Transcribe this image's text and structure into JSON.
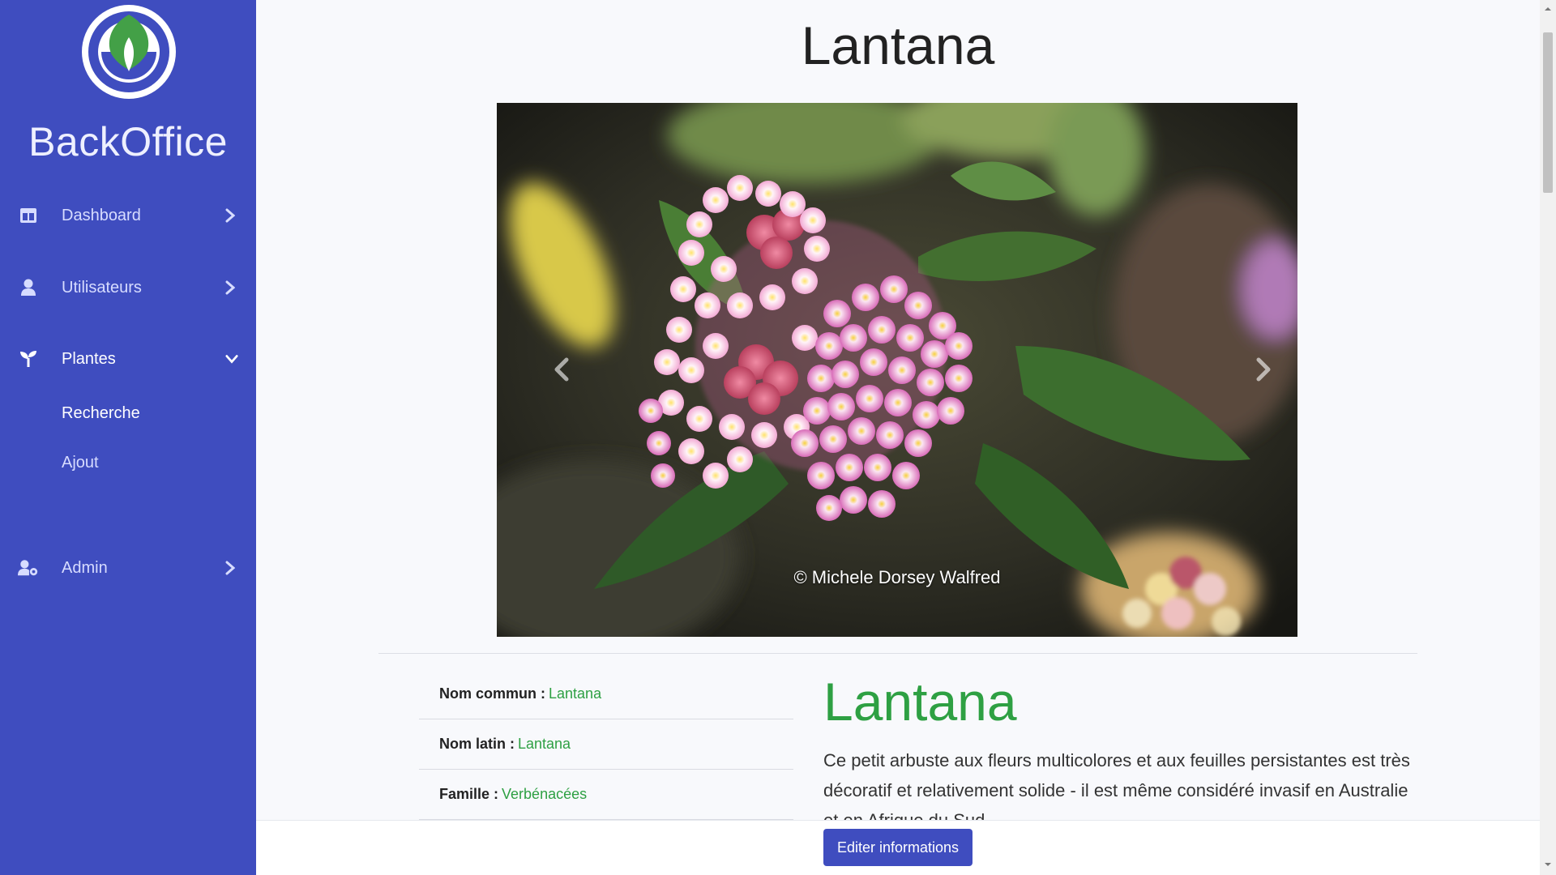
{
  "sidebar": {
    "brand": "BackOffice",
    "items": [
      {
        "label": "Dashboard",
        "icon": "dashboard-icon"
      },
      {
        "label": "Utilisateurs",
        "icon": "user-icon"
      },
      {
        "label": "Plantes",
        "icon": "sprout-icon",
        "expanded": true
      },
      {
        "label": "Admin",
        "icon": "user-cog-icon"
      }
    ],
    "submenu": [
      {
        "label": "Recherche",
        "active": true
      },
      {
        "label": "Ajout"
      }
    ]
  },
  "page": {
    "title": "Lantana"
  },
  "carousel": {
    "caption": "© Michele Dorsey Walfred"
  },
  "info": {
    "rows": [
      {
        "label": "Nom commun :",
        "value": "Lantana"
      },
      {
        "label": "Nom latin :",
        "value": "Lantana"
      },
      {
        "label": "Famille :",
        "value": "Verbénacées"
      }
    ]
  },
  "detail": {
    "name": "Lantana",
    "description": "Ce petit arbuste aux fleurs multicolores et aux feuilles persistantes est très décoratif et relativement solide - il est même considéré invasif en Australie et en Afrique du Sud."
  },
  "actions": {
    "edit_label": "Editer informations"
  },
  "colors": {
    "sidebar": "#3f4dbf",
    "accent_green": "#2ea043",
    "button": "#3f4dbf"
  }
}
